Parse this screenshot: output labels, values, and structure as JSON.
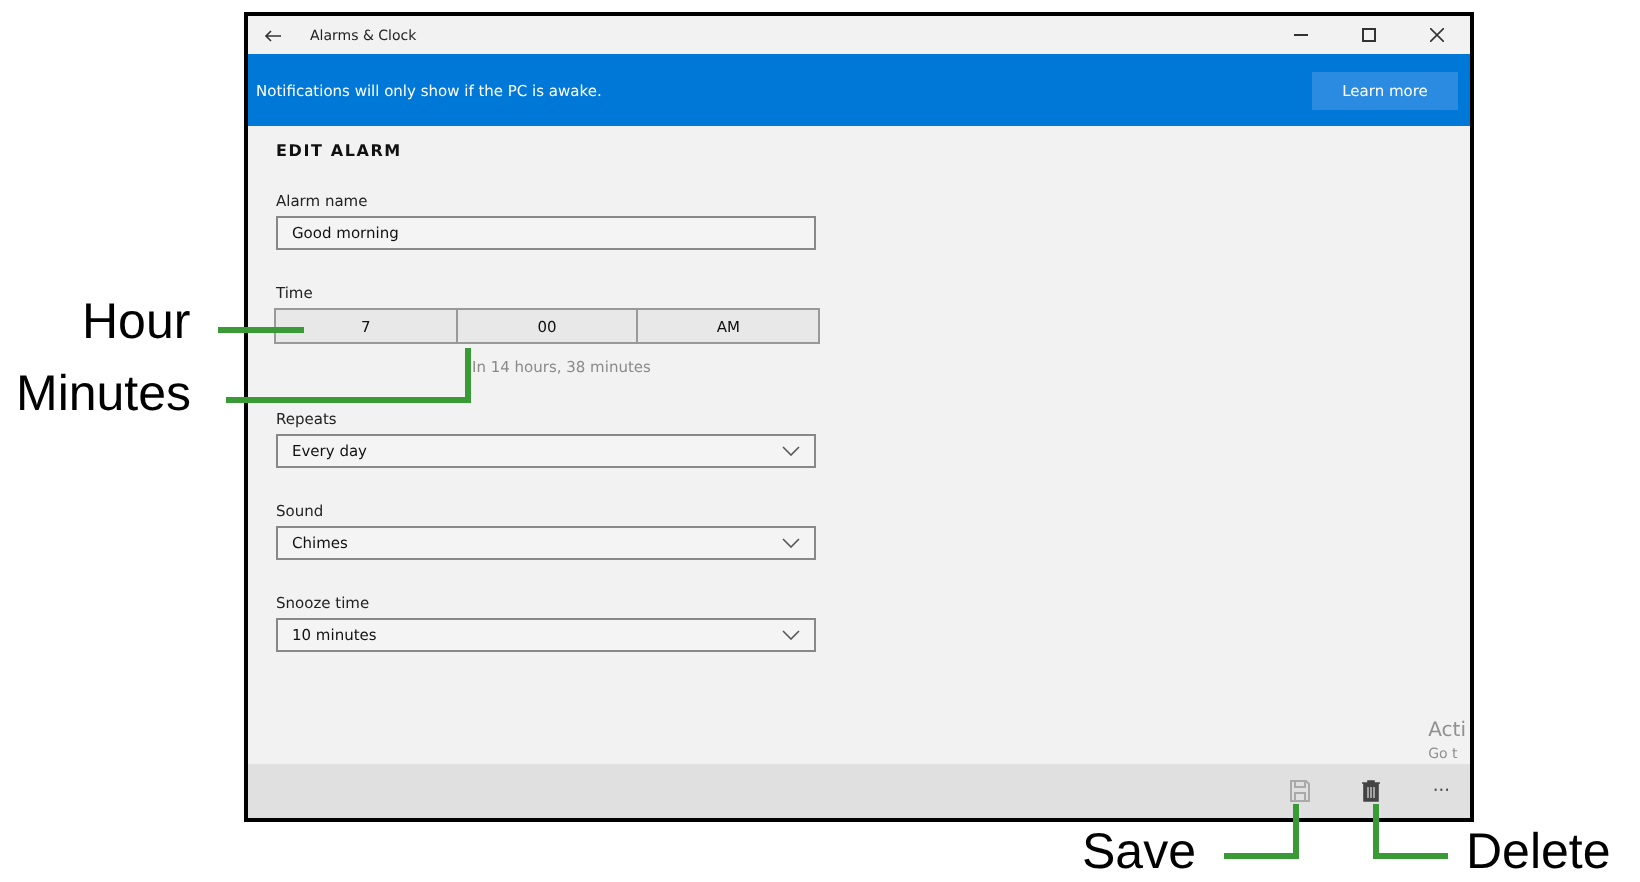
{
  "window": {
    "title": "Alarms & Clock"
  },
  "banner": {
    "message": "Notifications will only show if the PC is awake.",
    "button": "Learn more"
  },
  "heading": "EDIT ALARM",
  "alarm_name": {
    "label": "Alarm name",
    "value": "Good morning"
  },
  "time": {
    "label": "Time",
    "hour": "7",
    "minutes": "00",
    "period": "AM",
    "hint": "In 14 hours, 38 minutes"
  },
  "dropdowns": [
    {
      "label": "Repeats",
      "value": "Every day"
    },
    {
      "label": "Sound",
      "value": "Chimes"
    },
    {
      "label": "Snooze time",
      "value": "10 minutes"
    }
  ],
  "command_bar": {
    "save": {
      "disabled": true
    },
    "delete": {
      "disabled": false
    },
    "more": "···"
  },
  "activation_notice": {
    "title": "Acti",
    "subtitle": "Go t"
  },
  "callouts": [
    {
      "kind": "hour",
      "text": "Hour"
    },
    {
      "kind": "minutes",
      "text": "Minutes"
    },
    {
      "kind": "save",
      "text": "Save"
    },
    {
      "kind": "delete",
      "text": "Delete"
    }
  ]
}
